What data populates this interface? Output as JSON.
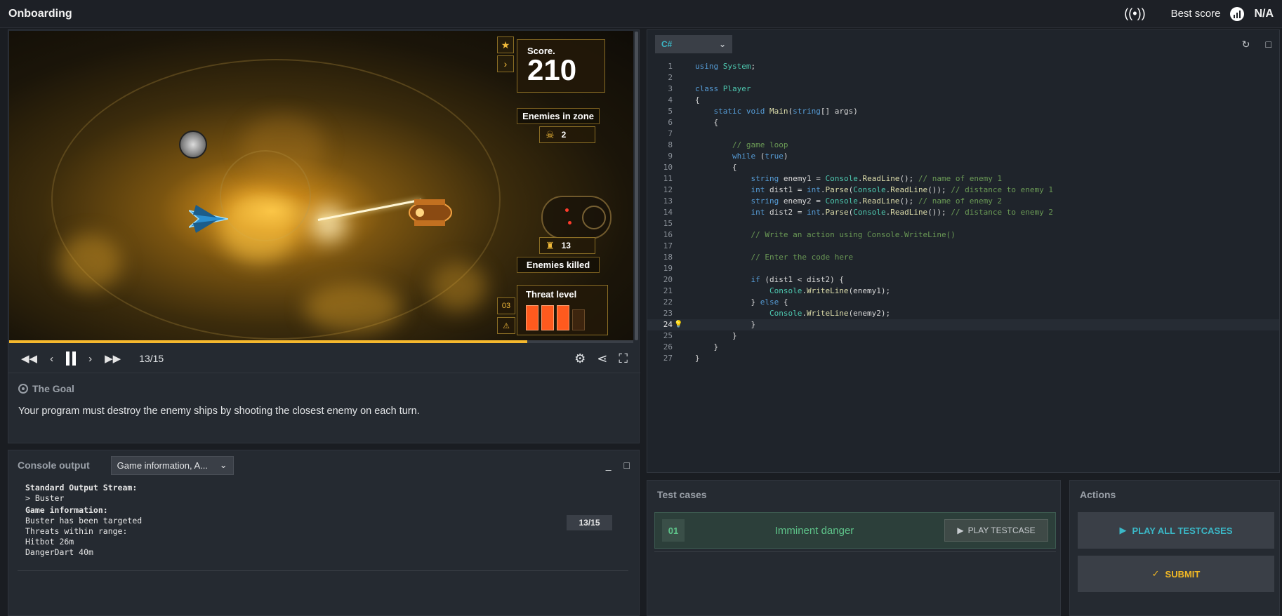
{
  "app": {
    "title": "Onboarding"
  },
  "header": {
    "best_score_label": "Best score",
    "best_score_value": "N/A"
  },
  "game": {
    "score_label": "Score.",
    "score_value": "210",
    "enemies_in_zone_label": "Enemies in zone",
    "enemies_in_zone_value": "2",
    "enemies_killed_label": "Enemies killed",
    "enemies_killed_value": "13",
    "threat_label": "Threat level",
    "threat_level_code": "03",
    "threat_bars_lit": 3,
    "threat_bars_total": 4,
    "progress_fraction": 0.83
  },
  "player": {
    "frame": "13/15"
  },
  "goal": {
    "title": "The Goal",
    "text": "Your program must destroy the enemy ships by shooting the closest enemy on each turn."
  },
  "console": {
    "title": "Console output",
    "filter": "Game information, A...",
    "stdout_label": "Standard Output Stream:",
    "stdout_line": "> Buster",
    "info_label": "Game information:",
    "info_lines": [
      "Buster has been targeted",
      "Threats within range:",
      "Hitbot 26m",
      "DangerDart 40m"
    ],
    "frame_badge": "13/15"
  },
  "editor": {
    "language": "C#",
    "active_line": 24,
    "lines": [
      [
        [
          "kw",
          "using"
        ],
        [
          "tx",
          " "
        ],
        [
          "ty",
          "System"
        ],
        [
          "tx",
          ";"
        ]
      ],
      [],
      [
        [
          "kw",
          "class"
        ],
        [
          "tx",
          " "
        ],
        [
          "ty",
          "Player"
        ]
      ],
      [
        [
          "tx",
          "{"
        ]
      ],
      [
        [
          "tx",
          "    "
        ],
        [
          "kw",
          "static"
        ],
        [
          "tx",
          " "
        ],
        [
          "kw",
          "void"
        ],
        [
          "tx",
          " "
        ],
        [
          "fn",
          "Main"
        ],
        [
          "tx",
          "("
        ],
        [
          "kw",
          "string"
        ],
        [
          "tx",
          "[] args)"
        ]
      ],
      [
        [
          "tx",
          "    {"
        ]
      ],
      [],
      [
        [
          "tx",
          "        "
        ],
        [
          "cm",
          "// game loop"
        ]
      ],
      [
        [
          "tx",
          "        "
        ],
        [
          "kw",
          "while"
        ],
        [
          "tx",
          " ("
        ],
        [
          "kw",
          "true"
        ],
        [
          "tx",
          ")"
        ]
      ],
      [
        [
          "tx",
          "        {"
        ]
      ],
      [
        [
          "tx",
          "            "
        ],
        [
          "kw",
          "string"
        ],
        [
          "tx",
          " enemy1 = "
        ],
        [
          "ty",
          "Console"
        ],
        [
          "tx",
          "."
        ],
        [
          "fn",
          "ReadLine"
        ],
        [
          "tx",
          "(); "
        ],
        [
          "cm",
          "// name of enemy 1"
        ]
      ],
      [
        [
          "tx",
          "            "
        ],
        [
          "kw",
          "int"
        ],
        [
          "tx",
          " dist1 = "
        ],
        [
          "kw",
          "int"
        ],
        [
          "tx",
          "."
        ],
        [
          "fn",
          "Parse"
        ],
        [
          "tx",
          "("
        ],
        [
          "ty",
          "Console"
        ],
        [
          "tx",
          "."
        ],
        [
          "fn",
          "ReadLine"
        ],
        [
          "tx",
          "()); "
        ],
        [
          "cm",
          "// distance to enemy 1"
        ]
      ],
      [
        [
          "tx",
          "            "
        ],
        [
          "kw",
          "string"
        ],
        [
          "tx",
          " enemy2 = "
        ],
        [
          "ty",
          "Console"
        ],
        [
          "tx",
          "."
        ],
        [
          "fn",
          "ReadLine"
        ],
        [
          "tx",
          "(); "
        ],
        [
          "cm",
          "// name of enemy 2"
        ]
      ],
      [
        [
          "tx",
          "            "
        ],
        [
          "kw",
          "int"
        ],
        [
          "tx",
          " dist2 = "
        ],
        [
          "kw",
          "int"
        ],
        [
          "tx",
          "."
        ],
        [
          "fn",
          "Parse"
        ],
        [
          "tx",
          "("
        ],
        [
          "ty",
          "Console"
        ],
        [
          "tx",
          "."
        ],
        [
          "fn",
          "ReadLine"
        ],
        [
          "tx",
          "()); "
        ],
        [
          "cm",
          "// distance to enemy 2"
        ]
      ],
      [],
      [
        [
          "tx",
          "            "
        ],
        [
          "cm",
          "// Write an action using Console.WriteLine()"
        ]
      ],
      [],
      [
        [
          "tx",
          "            "
        ],
        [
          "cm",
          "// Enter the code here"
        ]
      ],
      [],
      [
        [
          "tx",
          "            "
        ],
        [
          "kw",
          "if"
        ],
        [
          "tx",
          " (dist1 < dist2) {"
        ]
      ],
      [
        [
          "tx",
          "                "
        ],
        [
          "ty",
          "Console"
        ],
        [
          "tx",
          "."
        ],
        [
          "fn",
          "WriteLine"
        ],
        [
          "tx",
          "(enemy1);"
        ]
      ],
      [
        [
          "tx",
          "            } "
        ],
        [
          "kw",
          "else"
        ],
        [
          "tx",
          " {"
        ]
      ],
      [
        [
          "tx",
          "                "
        ],
        [
          "ty",
          "Console"
        ],
        [
          "tx",
          "."
        ],
        [
          "fn",
          "WriteLine"
        ],
        [
          "tx",
          "(enemy2);"
        ]
      ],
      [
        [
          "tx",
          "            }"
        ]
      ],
      [
        [
          "tx",
          "        }"
        ]
      ],
      [
        [
          "tx",
          "    }"
        ]
      ],
      [
        [
          "tx",
          "}"
        ]
      ]
    ]
  },
  "tests": {
    "title": "Test cases",
    "items": [
      {
        "num": "01",
        "name": "Imminent danger",
        "play_label": "PLAY TESTCASE"
      }
    ]
  },
  "actions": {
    "title": "Actions",
    "play_all_label": "PLAY ALL TESTCASES",
    "submit_label": "SUBMIT"
  },
  "icons": {
    "broadcast": "broadcast-icon",
    "best_score": "chart-icon",
    "rewind": "rewind-icon",
    "step_back": "step-back-icon",
    "pause": "pause-icon",
    "step_forward": "step-forward-icon",
    "fast_forward": "fast-forward-icon",
    "settings": "gear-icon",
    "share": "share-icon",
    "fullscreen": "fullscreen-icon",
    "goal": "target-icon",
    "reset": "reset-icon",
    "maximize": "maximize-icon",
    "bulb": "lightbulb-icon"
  }
}
